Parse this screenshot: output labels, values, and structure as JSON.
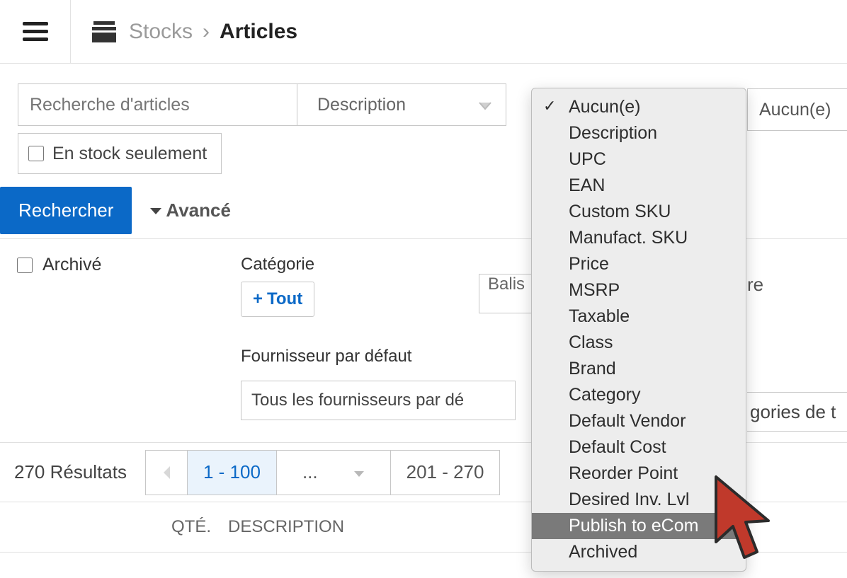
{
  "breadcrumb": {
    "parent": "Stocks",
    "sep": "›",
    "current": "Articles"
  },
  "search": {
    "placeholder": "Recherche d'articles",
    "desc_dropdown": "Description",
    "right_dropdown": "Aucun(e)",
    "stock_only": "En stock seulement",
    "button": "Rechercher",
    "advanced": "Avancé"
  },
  "advanced": {
    "archived": "Archivé",
    "category_label": "Catégorie",
    "category_btn": "Tout",
    "supplier_label": "Fournisseur par défaut",
    "supplier_value": "Tous les fournisseurs par dé",
    "balis_frag": "Balis",
    "re_frag": "re",
    "gories_frag": "gories de t"
  },
  "results": {
    "count": "270 Résultats",
    "page_current": "1 - 100",
    "page_dots": "...",
    "page_last": "201 - 270"
  },
  "table": {
    "qty": "QTÉ.",
    "desc": "DESCRIPTION"
  },
  "popup": {
    "items": [
      "Aucun(e)",
      "Description",
      "UPC",
      "EAN",
      "Custom SKU",
      "Manufact. SKU",
      "Price",
      "MSRP",
      "Taxable",
      "Class",
      "Brand",
      "Category",
      "Default Vendor",
      "Default Cost",
      "Reorder Point",
      "Desired Inv. Lvl",
      "Publish to eCom",
      "Archived"
    ],
    "checked_index": 0,
    "selected_index": 16
  }
}
